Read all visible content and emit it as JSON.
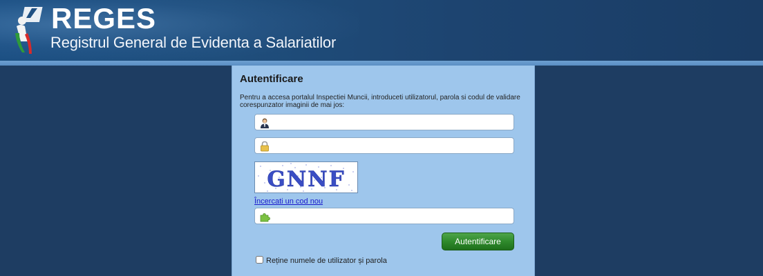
{
  "header": {
    "brand": "REGES",
    "subtitle": "Registrul General de Evidenta a Salariatilor"
  },
  "login": {
    "title": "Autentificare",
    "description": "Pentru a accesa portalul Inspectiei Muncii, introduceti utilizatorul, parola si codul de validare corespunzator imaginii de mai jos:",
    "username": {
      "value": "",
      "icon": "user-icon"
    },
    "password": {
      "value": "",
      "icon": "lock-icon"
    },
    "captcha": {
      "text": "GNNF"
    },
    "new_code_link": "Încercati un cod nou",
    "code": {
      "value": "",
      "icon": "puzzle-icon"
    },
    "submit_label": "Autentificare",
    "remember_label": "Reține numele de utilizator și parola",
    "remember_checked": false
  },
  "colors": {
    "page_bg": "#1e3d62",
    "header_band": "#6d9fd0",
    "panel_bg": "#9ec6ec",
    "button_green": "#2f8a2c",
    "link": "#1a1acc"
  }
}
